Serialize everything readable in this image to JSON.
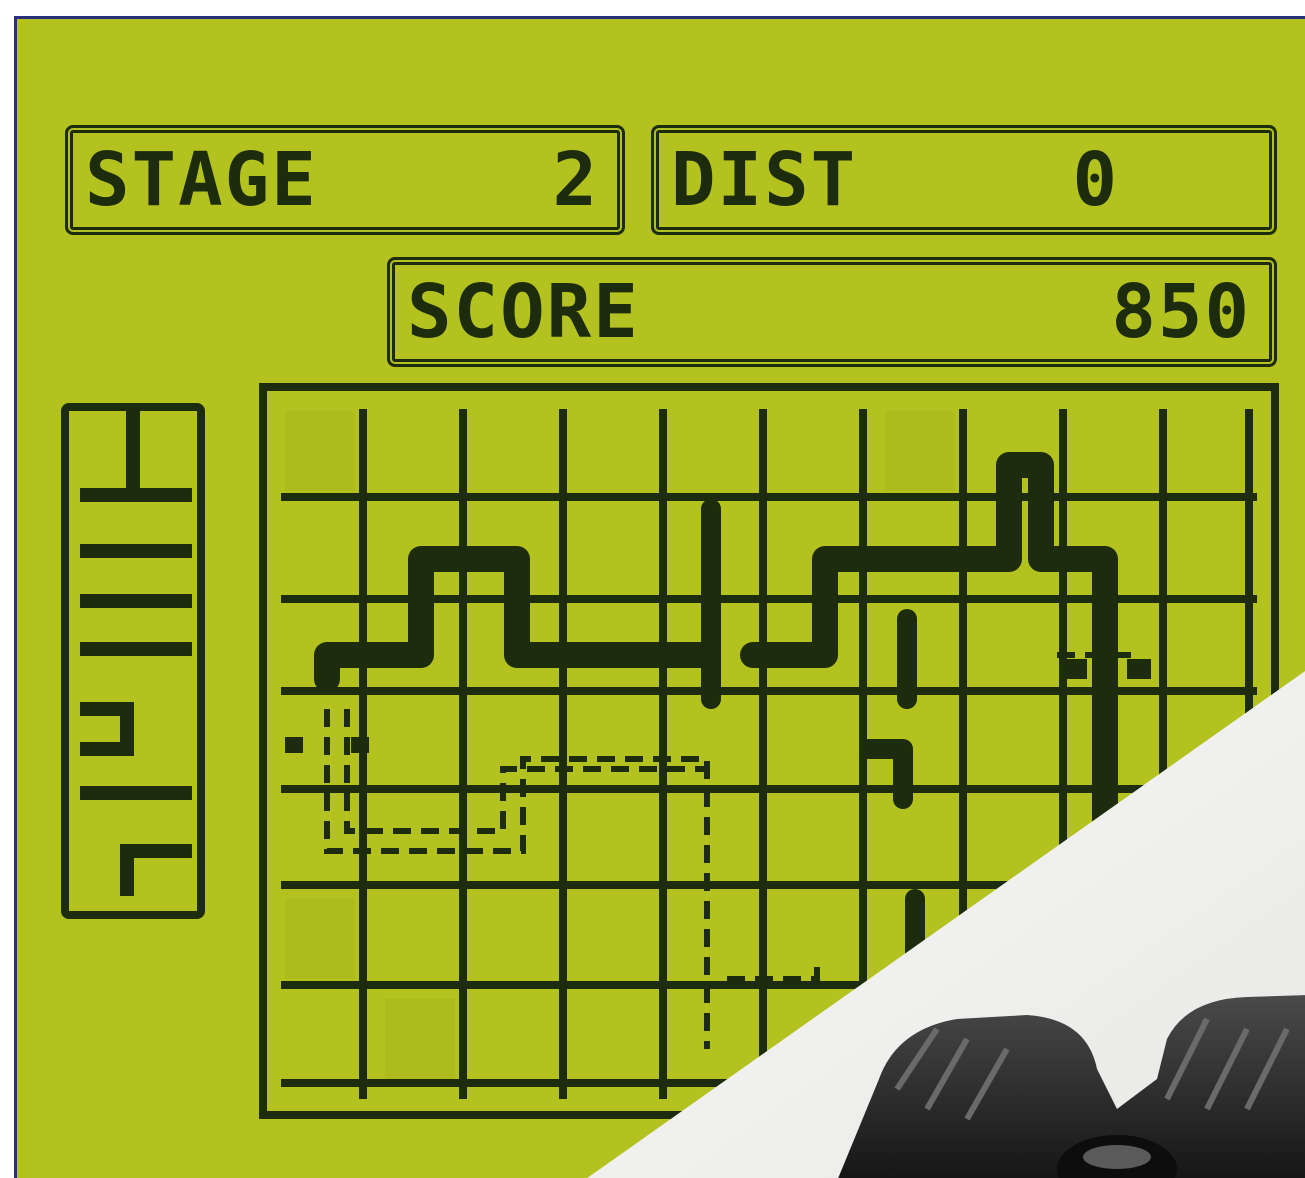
{
  "hud": {
    "stage_label": "STAGE",
    "stage_value": "2",
    "dist_label": "DIST",
    "dist_value": "0",
    "score_label": "SCORE",
    "score_value": "850"
  },
  "colors": {
    "lcd_background": "#b3c21f",
    "lcd_pixel_dark": "#1c2c0c",
    "frame_edge": "#2a2f7a",
    "device_plastic": "#f3f3f1",
    "device_buttons": "#222222"
  },
  "board": {
    "columns": 10,
    "rows": 7
  },
  "icons": [
    "pipe-segment-icon",
    "pipe-corner-icon",
    "controller-buttons-icon"
  ]
}
